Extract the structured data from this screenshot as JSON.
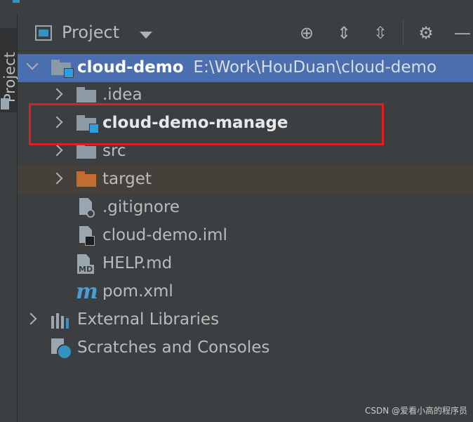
{
  "sidebar": {
    "tab_label": "Project"
  },
  "toolbar": {
    "title": "Project",
    "icons": [
      "project-window-icon",
      "dropdown-caret-icon",
      "locate-icon",
      "expand-all-icon",
      "collapse-all-icon",
      "gear-icon",
      "minimize-icon"
    ]
  },
  "tree": {
    "root": {
      "name": "cloud-demo",
      "path": "E:\\Work\\HouDuan\\cloud-demo"
    },
    "children": [
      {
        "name": ".idea"
      },
      {
        "name": "cloud-demo-manage"
      },
      {
        "name": "src"
      },
      {
        "name": "target"
      },
      {
        "name": ".gitignore"
      },
      {
        "name": "cloud-demo.iml"
      },
      {
        "name": "HELP.md",
        "icon_text": "MD"
      },
      {
        "name": "pom.xml",
        "icon_text": "m"
      }
    ],
    "external_libraries": "External Libraries",
    "scratches": "Scratches and Consoles"
  },
  "colors": {
    "selection": "#4b6eaf",
    "highlight_box": "#e02020",
    "module_badge": "#2d9fe0",
    "target_folder": "#c26c32"
  },
  "watermark": "CSDN @爱看小高的程序员"
}
